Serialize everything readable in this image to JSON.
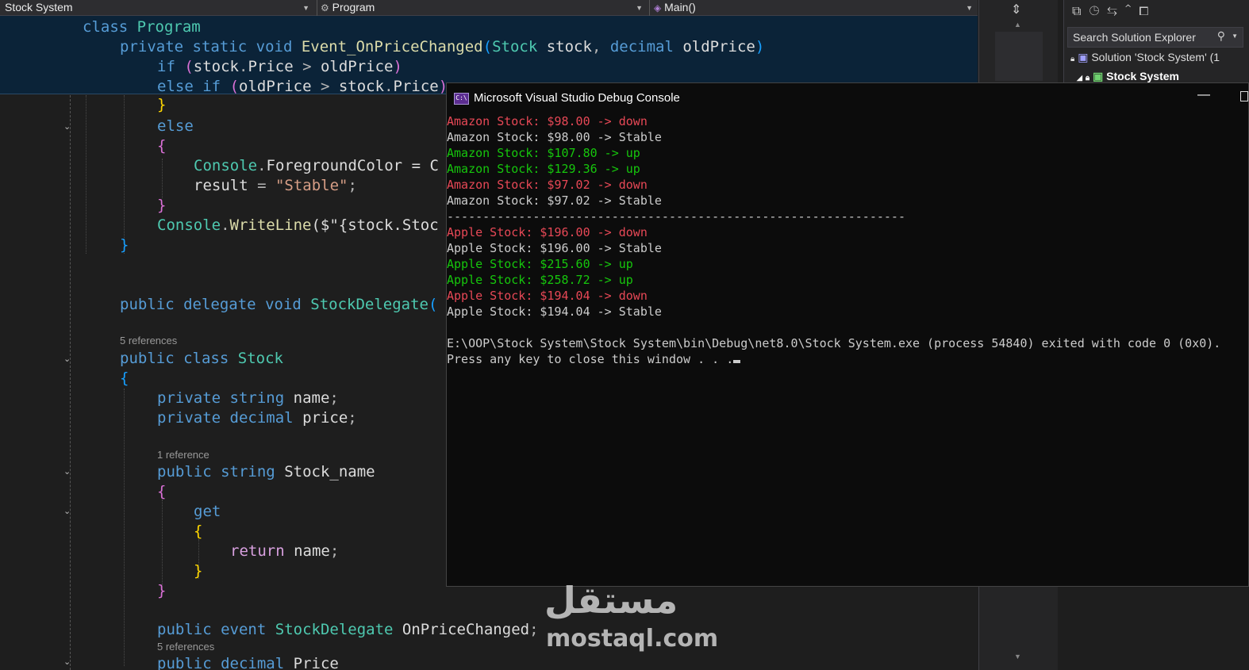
{
  "nav": {
    "project": "Stock System",
    "class": "Program",
    "member": "Main()"
  },
  "sticky": {
    "l1": [
      "class",
      "Program"
    ],
    "l2": [
      "private",
      "static",
      "void",
      "Event_OnPriceChanged",
      "(",
      "Stock",
      "stock",
      ", ",
      "decimal",
      "oldPrice",
      ")"
    ],
    "l3": [
      "if",
      "(",
      "stock",
      ".",
      "Price",
      " > ",
      "oldPrice",
      ")"
    ],
    "l4": [
      "else",
      "if",
      "(",
      "oldPrice",
      " > ",
      "stock",
      ".",
      "Price",
      ")"
    ]
  },
  "code": {
    "close1": "}",
    "else": "else",
    "open2": "{",
    "fg_console": "Console",
    "fg_prop": "ForegroundColor",
    "fg_rest": " = C",
    "result": "result",
    "result_eq": " = ",
    "result_str": "\"Stable\"",
    "semicolon": ";",
    "close3": "}",
    "wl_console": "Console",
    "wl_method": "WriteLine",
    "wl_rest": "($\"{stock.Stoc",
    "close4": "}",
    "del_line": [
      "public",
      "delegate",
      "void",
      "StockDelegate",
      "("
    ],
    "refs_stock": "5 references",
    "class_line": [
      "public",
      "class",
      "Stock"
    ],
    "open_cls": "{",
    "f1": [
      "private",
      "string",
      "name",
      ";"
    ],
    "f2": [
      "private",
      "decimal",
      "price",
      ";"
    ],
    "refs_sn": "1 reference",
    "prop_line": [
      "public",
      "string",
      "Stock_name"
    ],
    "open_p": "{",
    "get": "get",
    "open_g": "{",
    "ret": [
      "return",
      "name",
      ";"
    ],
    "close_g": "}",
    "close_p": "}",
    "event_line": [
      "public",
      "event",
      "StockDelegate",
      "OnPriceChanged",
      ";"
    ],
    "refs_price": "5 references",
    "price_line": [
      "public",
      "decimal",
      "Price"
    ]
  },
  "solution_explorer": {
    "search_placeholder": "Search Solution Explorer",
    "solution_label": "Solution 'Stock System' (1",
    "project_label": "Stock System"
  },
  "console": {
    "title": "Microsoft Visual Studio Debug Console",
    "icon_text": "C:\\",
    "lines": [
      {
        "text": "Amazon Stock: $98.00 -> down",
        "color": "red"
      },
      {
        "text": "Amazon Stock: $98.00 -> Stable",
        "color": "white"
      },
      {
        "text": "Amazon Stock: $107.80 -> up",
        "color": "green"
      },
      {
        "text": "Amazon Stock: $129.36 -> up",
        "color": "green"
      },
      {
        "text": "Amazon Stock: $97.02 -> down",
        "color": "red"
      },
      {
        "text": "Amazon Stock: $97.02 -> Stable",
        "color": "white"
      },
      {
        "text": "----------------------------------------------------------------",
        "color": "white"
      },
      {
        "text": "Apple Stock: $196.00 -> down",
        "color": "red"
      },
      {
        "text": "Apple Stock: $196.00 -> Stable",
        "color": "white"
      },
      {
        "text": "Apple Stock: $215.60 -> up",
        "color": "green"
      },
      {
        "text": "Apple Stock: $258.72 -> up",
        "color": "green"
      },
      {
        "text": "Apple Stock: $194.04 -> down",
        "color": "red"
      },
      {
        "text": "Apple Stock: $194.04 -> Stable",
        "color": "white"
      },
      {
        "text": "",
        "color": "white"
      },
      {
        "text": "E:\\OOP\\Stock System\\Stock System\\bin\\Debug\\net8.0\\Stock System.exe (process 54840) exited with code 0 (0x0).",
        "color": "white"
      },
      {
        "text": "Press any key to close this window . . .",
        "color": "white"
      }
    ]
  },
  "watermark": {
    "arabic": "مستقل",
    "latin": "mostaql.com"
  },
  "colors": {
    "console_red": "#e74856",
    "console_green": "#16c60c",
    "console_white": "#cccccc",
    "keyword": "#569cd6",
    "type": "#4ec9b0",
    "method": "#dcdcaa",
    "string": "#d69d85"
  }
}
